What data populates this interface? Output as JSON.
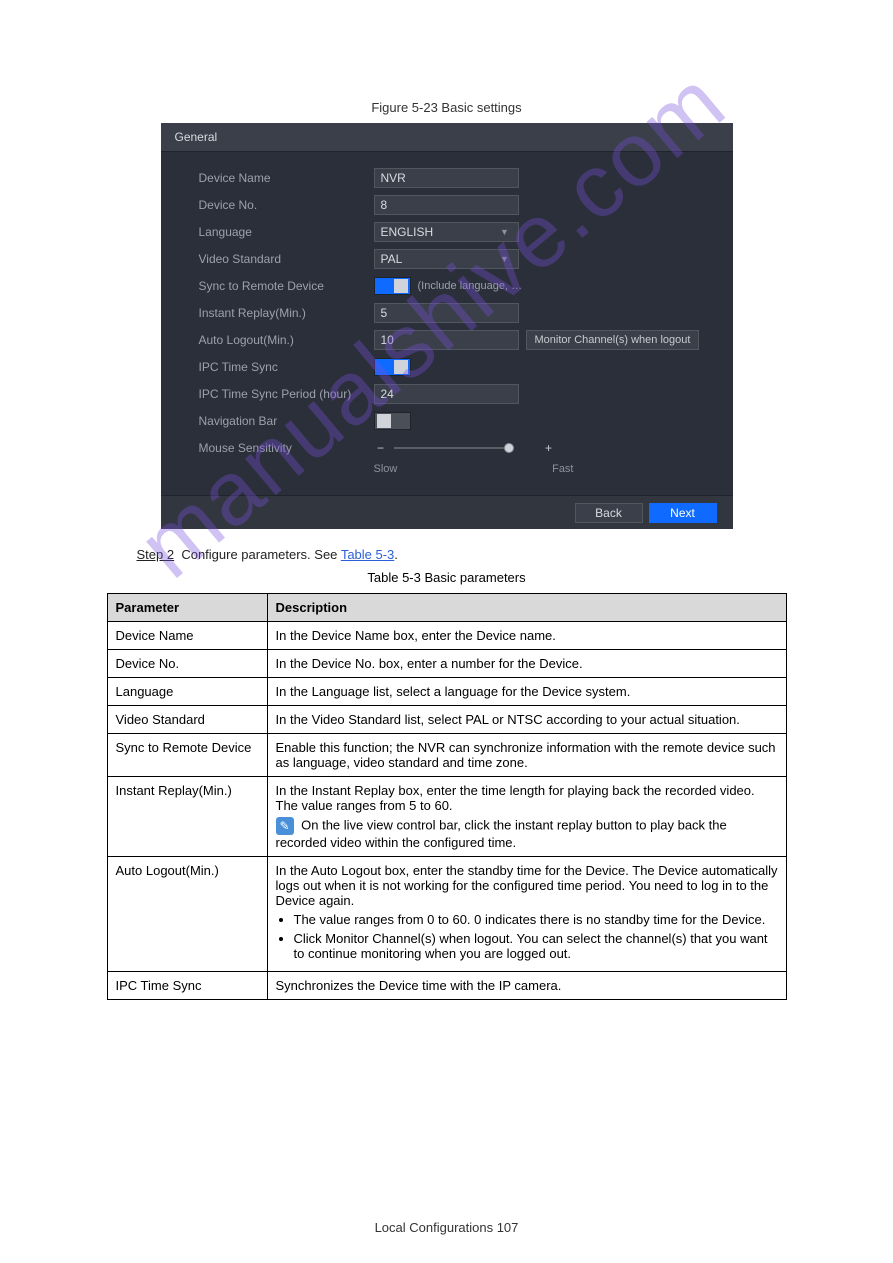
{
  "figure_caption": "Figure 5-23 Basic settings",
  "watermark": "manualshive.com",
  "panel": {
    "title": "General",
    "rows": {
      "device_name": {
        "label": "Device Name",
        "value": "NVR"
      },
      "device_no": {
        "label": "Device No.",
        "value": "8"
      },
      "language": {
        "label": "Language",
        "value": "ENGLISH"
      },
      "video_std": {
        "label": "Video Standard",
        "value": "PAL"
      },
      "sync_remote": {
        "label": "Sync to Remote Device",
        "hint": "(Include language, …"
      },
      "instant_replay": {
        "label": "Instant Replay(Min.)",
        "value": "5"
      },
      "auto_logout": {
        "label": "Auto Logout(Min.)",
        "value": "10",
        "side_button": "Monitor Channel(s) when logout"
      },
      "ipc_time_sync": {
        "label": "IPC Time Sync"
      },
      "ipc_time_sync_period": {
        "label": "IPC Time Sync Period (hour)",
        "value": "24"
      },
      "nav_bar": {
        "label": "Navigation Bar"
      },
      "mouse_sens": {
        "label": "Mouse Sensitivity",
        "slow": "Slow",
        "fast": "Fast"
      }
    },
    "footer": {
      "back": "Back",
      "next": "Next"
    }
  },
  "step2_prefix": "Step 2",
  "step2": "Configure parameters. See",
  "step2_link": "Table 5-3",
  "step2_suffix": ".",
  "table_caption": "Table 5-3 Basic parameters",
  "table": {
    "head": {
      "param": "Parameter",
      "desc": "Description"
    },
    "rows": [
      {
        "p": "Device Name",
        "d": "In the Device Name box, enter the Device name."
      },
      {
        "p": "Device No.",
        "d": "In the Device No. box, enter a number for the Device."
      },
      {
        "p": "Language",
        "d": "In the Language list, select a language for the Device system."
      },
      {
        "p": "Video Standard",
        "d": "In the Video Standard list, select PAL or NTSC according to your actual situation."
      },
      {
        "p": "Sync to Remote Device",
        "d": "Enable this function; the NVR can synchronize information with the remote device such as language, video standard and time zone."
      },
      {
        "p": "Instant Replay(Min.)",
        "d": "In the Instant Replay box, enter the time length for playing back the recorded video. The value ranges from 5 to 60.",
        "note": "On the live view control bar, click the instant replay button to play back the recorded video within the configured time."
      },
      {
        "p": "Auto Logout(Min.)",
        "d": "In the Auto Logout box, enter the standby time for the Device. The Device automatically logs out when it is not working for the configured time period. You need to log in to the Device again.",
        "bullets": [
          "The value ranges from 0 to 60. 0 indicates there is no standby time for the Device.",
          "Click Monitor Channel(s) when logout. You can select the channel(s) that you want to continue monitoring when you are logged out."
        ]
      },
      {
        "p": "IPC Time Sync",
        "d": "Synchronizes the Device time with the IP camera."
      }
    ]
  },
  "page_footer": "Local Configurations 107"
}
